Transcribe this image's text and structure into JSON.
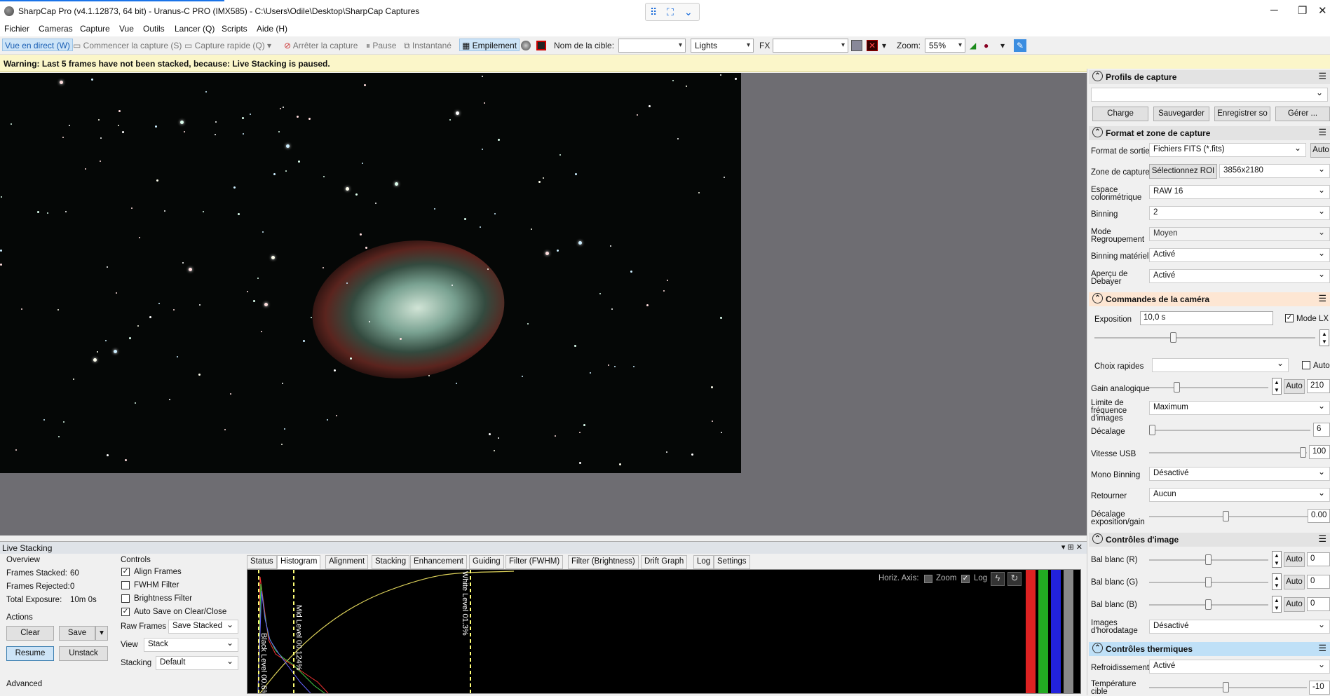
{
  "window": {
    "title": "SharpCap Pro (v4.1.12873, 64 bit) - Uranus-C PRO (IMX585) - C:\\Users\\Odile\\Desktop\\SharpCap Captures",
    "minimize": "─",
    "maximize": "❐",
    "close": "✕"
  },
  "menu": [
    "Fichier",
    "Cameras",
    "Capture",
    "Vue",
    "Outils",
    "Lancer (Q)",
    "Scripts",
    "Aide (H)"
  ],
  "toolbar": {
    "live": "Vue en direct (W)",
    "start": "Commencer la capture (S)",
    "quick": "Capture rapide (Q)",
    "stop": "Arrêter la capture",
    "pause": "Pause",
    "snapshot": "Instantané",
    "stacking": "Empilement",
    "target_label": "Nom de la cible:",
    "target_value": "",
    "frame_type": "Lights",
    "fx_label": "FX",
    "fx_value": "",
    "zoom_label": "Zoom:",
    "zoom_value": "55%"
  },
  "warning": "Warning: Last 5 frames have not been stacked, because: Live Stacking is paused.",
  "live_stacking": {
    "header": "Live Stacking",
    "overview": {
      "title": "Overview",
      "stacked_label": "Frames Stacked:",
      "stacked": "60",
      "rejected_label": "Frames Rejected:",
      "rejected": "0",
      "exposure_label": "Total Exposure:",
      "exposure": "10m 0s"
    },
    "actions": {
      "title": "Actions",
      "clear": "Clear",
      "save": "Save",
      "resume": "Resume",
      "unstack": "Unstack"
    },
    "advanced": "Advanced",
    "controls": {
      "title": "Controls",
      "align": "Align Frames",
      "fwhm": "FWHM Filter",
      "brightness": "Brightness Filter",
      "autosave": "Auto Save on Clear/Close",
      "raw_label": "Raw Frames",
      "raw_value": "Save Stacked",
      "view_label": "View",
      "view_value": "Stack",
      "stacking_label": "Stacking",
      "stacking_value": "Default"
    },
    "tabs": [
      "Status",
      "Histogram",
      "Alignment",
      "Stacking",
      "Enhancement",
      "Guiding",
      "Filter (FWHM)",
      "Filter (Brightness)",
      "Drift Graph",
      "Log",
      "Settings"
    ],
    "histogram": {
      "horiz_axis": "Horiz. Axis:",
      "zoom": "Zoom",
      "log": "Log",
      "black": "Black Level 00.6%",
      "mid": "Mid Level 00.124%",
      "white": "White Level 01.3%"
    }
  },
  "sidebar": {
    "profiles": {
      "title": "Profils de capture",
      "charge": "Charge",
      "save": "Sauvegarder",
      "save_as": "Enregistrer so",
      "manage": "Gérer ..."
    },
    "format": {
      "title": "Format et zone de capture",
      "out_label": "Format de sortie",
      "out_value": "Fichiers FITS (*.fits)",
      "auto": "Auto",
      "zone_label": "Zone de capture",
      "roi": "Sélectionnez ROI",
      "res": "3856x2180",
      "color_label": "Espace colorimétrique",
      "color_value": "RAW 16",
      "bin_label": "Binning",
      "bin_value": "2",
      "mode_label": "Mode Regroupement",
      "mode_value": "Moyen",
      "hw_label": "Binning matériel",
      "hw_value": "Activé",
      "debayer_label": "Aperçu de Debayer",
      "debayer_value": "Activé"
    },
    "camera": {
      "title": "Commandes de la caméra",
      "exp_label": "Exposition",
      "exp_value": "10,0 s",
      "lx": "Mode LX",
      "quick_label": "Choix rapides",
      "auto": "Auto",
      "gain_label": "Gain analogique",
      "gain_value": "210",
      "fps_label": "Limite de fréquence d'images",
      "fps_value": "Maximum",
      "offset_label": "Décalage",
      "offset_value": "6",
      "usb_label": "Vitesse USB",
      "usb_value": "100",
      "mono_label": "Mono Binning",
      "mono_value": "Désactivé",
      "flip_label": "Retourner",
      "flip_value": "Aucun",
      "expgain_label": "Décalage exposition/gain",
      "expgain_value": "0.00"
    },
    "image": {
      "title": "Contrôles d'image",
      "wbr_label": "Bal blanc (R)",
      "wbr": "0",
      "wbg_label": "Bal blanc (G)",
      "wbg": "0",
      "wbb_label": "Bal blanc (B)",
      "wbb": "0",
      "ts_label": "Images d'horodatage",
      "ts_value": "Désactivé"
    },
    "thermal": {
      "title": "Contrôles thermiques",
      "cool_label": "Refroidissement",
      "cool_value": "Activé",
      "temp_label": "Température cible",
      "temp_value": "-10"
    }
  }
}
